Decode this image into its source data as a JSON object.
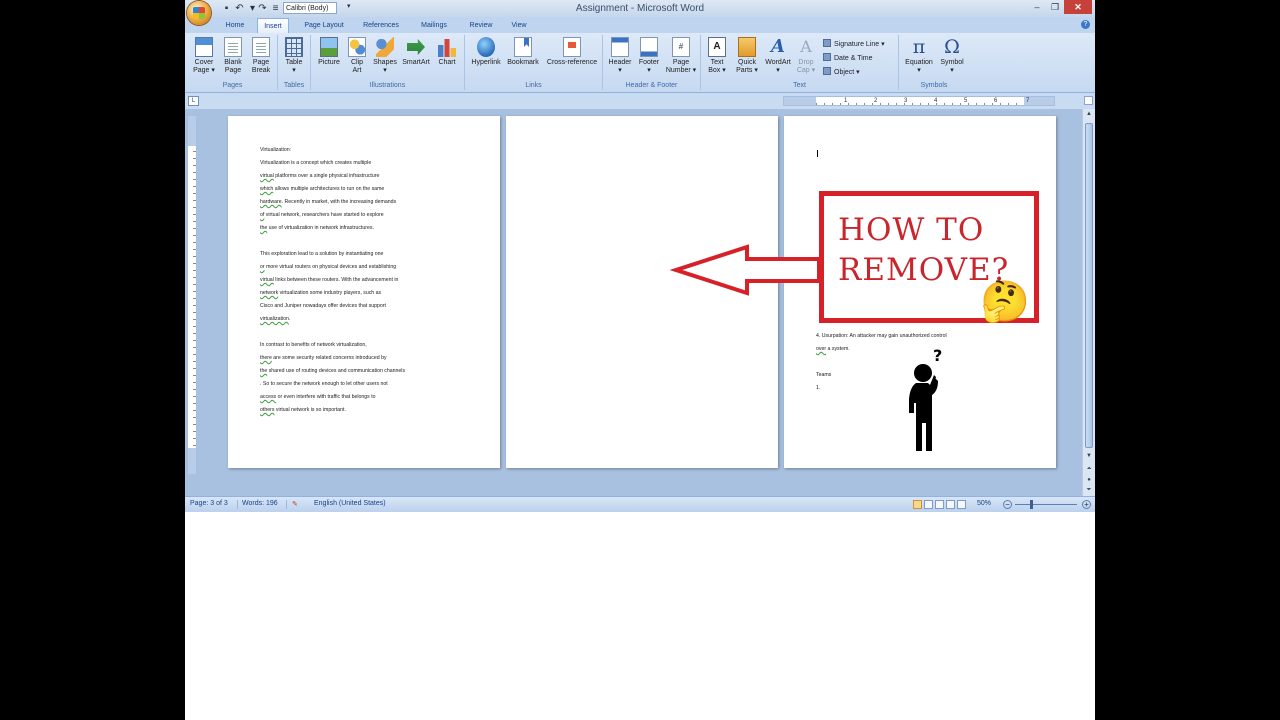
{
  "window": {
    "title": "Assignment - Microsoft Word",
    "font_name": "Calibri (Body)",
    "minimize": "–",
    "maximize": "❐",
    "close": "✕"
  },
  "tabs": [
    {
      "label": "Home"
    },
    {
      "label": "Insert",
      "active": true
    },
    {
      "label": "Page Layout"
    },
    {
      "label": "References"
    },
    {
      "label": "Mailings"
    },
    {
      "label": "Review"
    },
    {
      "label": "View"
    }
  ],
  "ribbon": {
    "pages": {
      "label": "Pages",
      "cover": {
        "l1": "Cover",
        "l2": "Page ▾"
      },
      "blank": {
        "l1": "Blank",
        "l2": "Page"
      },
      "break": {
        "l1": "Page",
        "l2": "Break"
      }
    },
    "tables": {
      "label": "Tables",
      "table": {
        "l1": "Table",
        "l2": "▾"
      }
    },
    "illustrations": {
      "label": "Illustrations",
      "picture": {
        "l1": "Picture"
      },
      "clipart": {
        "l1": "Clip",
        "l2": "Art"
      },
      "shapes": {
        "l1": "Shapes",
        "l2": "▾"
      },
      "smartart": {
        "l1": "SmartArt"
      },
      "chart": {
        "l1": "Chart"
      }
    },
    "links": {
      "label": "Links",
      "hyperlink": {
        "l1": "Hyperlink"
      },
      "bookmark": {
        "l1": "Bookmark"
      },
      "crossref": {
        "l1": "Cross-reference"
      }
    },
    "header_footer": {
      "label": "Header & Footer",
      "header": {
        "l1": "Header",
        "l2": "▾"
      },
      "footer": {
        "l1": "Footer",
        "l2": "▾"
      },
      "pagenum": {
        "l1": "Page",
        "l2": "Number ▾"
      }
    },
    "text": {
      "label": "Text",
      "textbox": {
        "l1": "Text",
        "l2": "Box ▾"
      },
      "quickparts": {
        "l1": "Quick",
        "l2": "Parts ▾"
      },
      "wordart": {
        "l1": "WordArt",
        "l2": "▾"
      },
      "dropcap": {
        "l1": "Drop",
        "l2": "Cap ▾"
      },
      "signature_line": "Signature Line ▾",
      "date_time": "Date & Time",
      "object": "Object ▾"
    },
    "symbols": {
      "label": "Symbols",
      "equation": {
        "l1": "Equation",
        "l2": "▾"
      },
      "symbol": {
        "l1": "Symbol",
        "l2": "▾"
      }
    }
  },
  "ruler_numbers": [
    "1",
    "2",
    "3",
    "4",
    "5",
    "6",
    "7"
  ],
  "page1_lines": [
    [
      "Virtualization:"
    ],
    [
      "Virtualization  is  a concept which creates  multiple"
    ],
    [
      "virtual",
      " platforms  over a single  physical infrastructure"
    ],
    [
      "which",
      " allows multiple  architectures to run on the same"
    ],
    [
      "hardware",
      ". Recently in market,  with  the increasing demands"
    ],
    [
      "of",
      " virtual network,  researchers have started to explore"
    ],
    [
      "the",
      " use of virtualization  in network infrastructures."
    ],
    [
      ""
    ],
    [
      "This exploration  lead to a solution by instantiating  one"
    ],
    [
      "or",
      " more virtual  routers on physical devices and establishing"
    ],
    [
      "virtual",
      " links  between these routers. With the advancement  in"
    ],
    [
      "network",
      " virtualization   some industry players,  such as"
    ],
    [
      "Cisco and Juniper nowadays  offer devices that support"
    ],
    [
      "virtualization",
      "."
    ],
    [
      ""
    ],
    [
      "In contrast to benefits of network virtualization,"
    ],
    [
      "there",
      " are some security related  concerns introduced by"
    ],
    [
      "the",
      " shared use of routing devices and communication  channels"
    ],
    [
      ". So to secure the network enough to let other users not"
    ],
    [
      "access",
      " or even interfere with traffic that belongs to"
    ],
    [
      "others",
      " virtual  network is so important."
    ]
  ],
  "page3_lines": [
    [
      "4. Usurpation: An attacker  may gain unauthorized control"
    ],
    [
      "      ",
      "over",
      " a system."
    ],
    [
      ""
    ],
    [
      "Teams"
    ],
    [
      "       1."
    ]
  ],
  "overlay": {
    "line1": "HOW TO",
    "line2": "REMOVE?",
    "emoji": "🤔",
    "person_mark": "?"
  },
  "status": {
    "page": "Page: 3 of 3",
    "words": "Words: 196",
    "language": "English (United States)",
    "zoom": "50%",
    "zoom_fraction": 0.5
  }
}
